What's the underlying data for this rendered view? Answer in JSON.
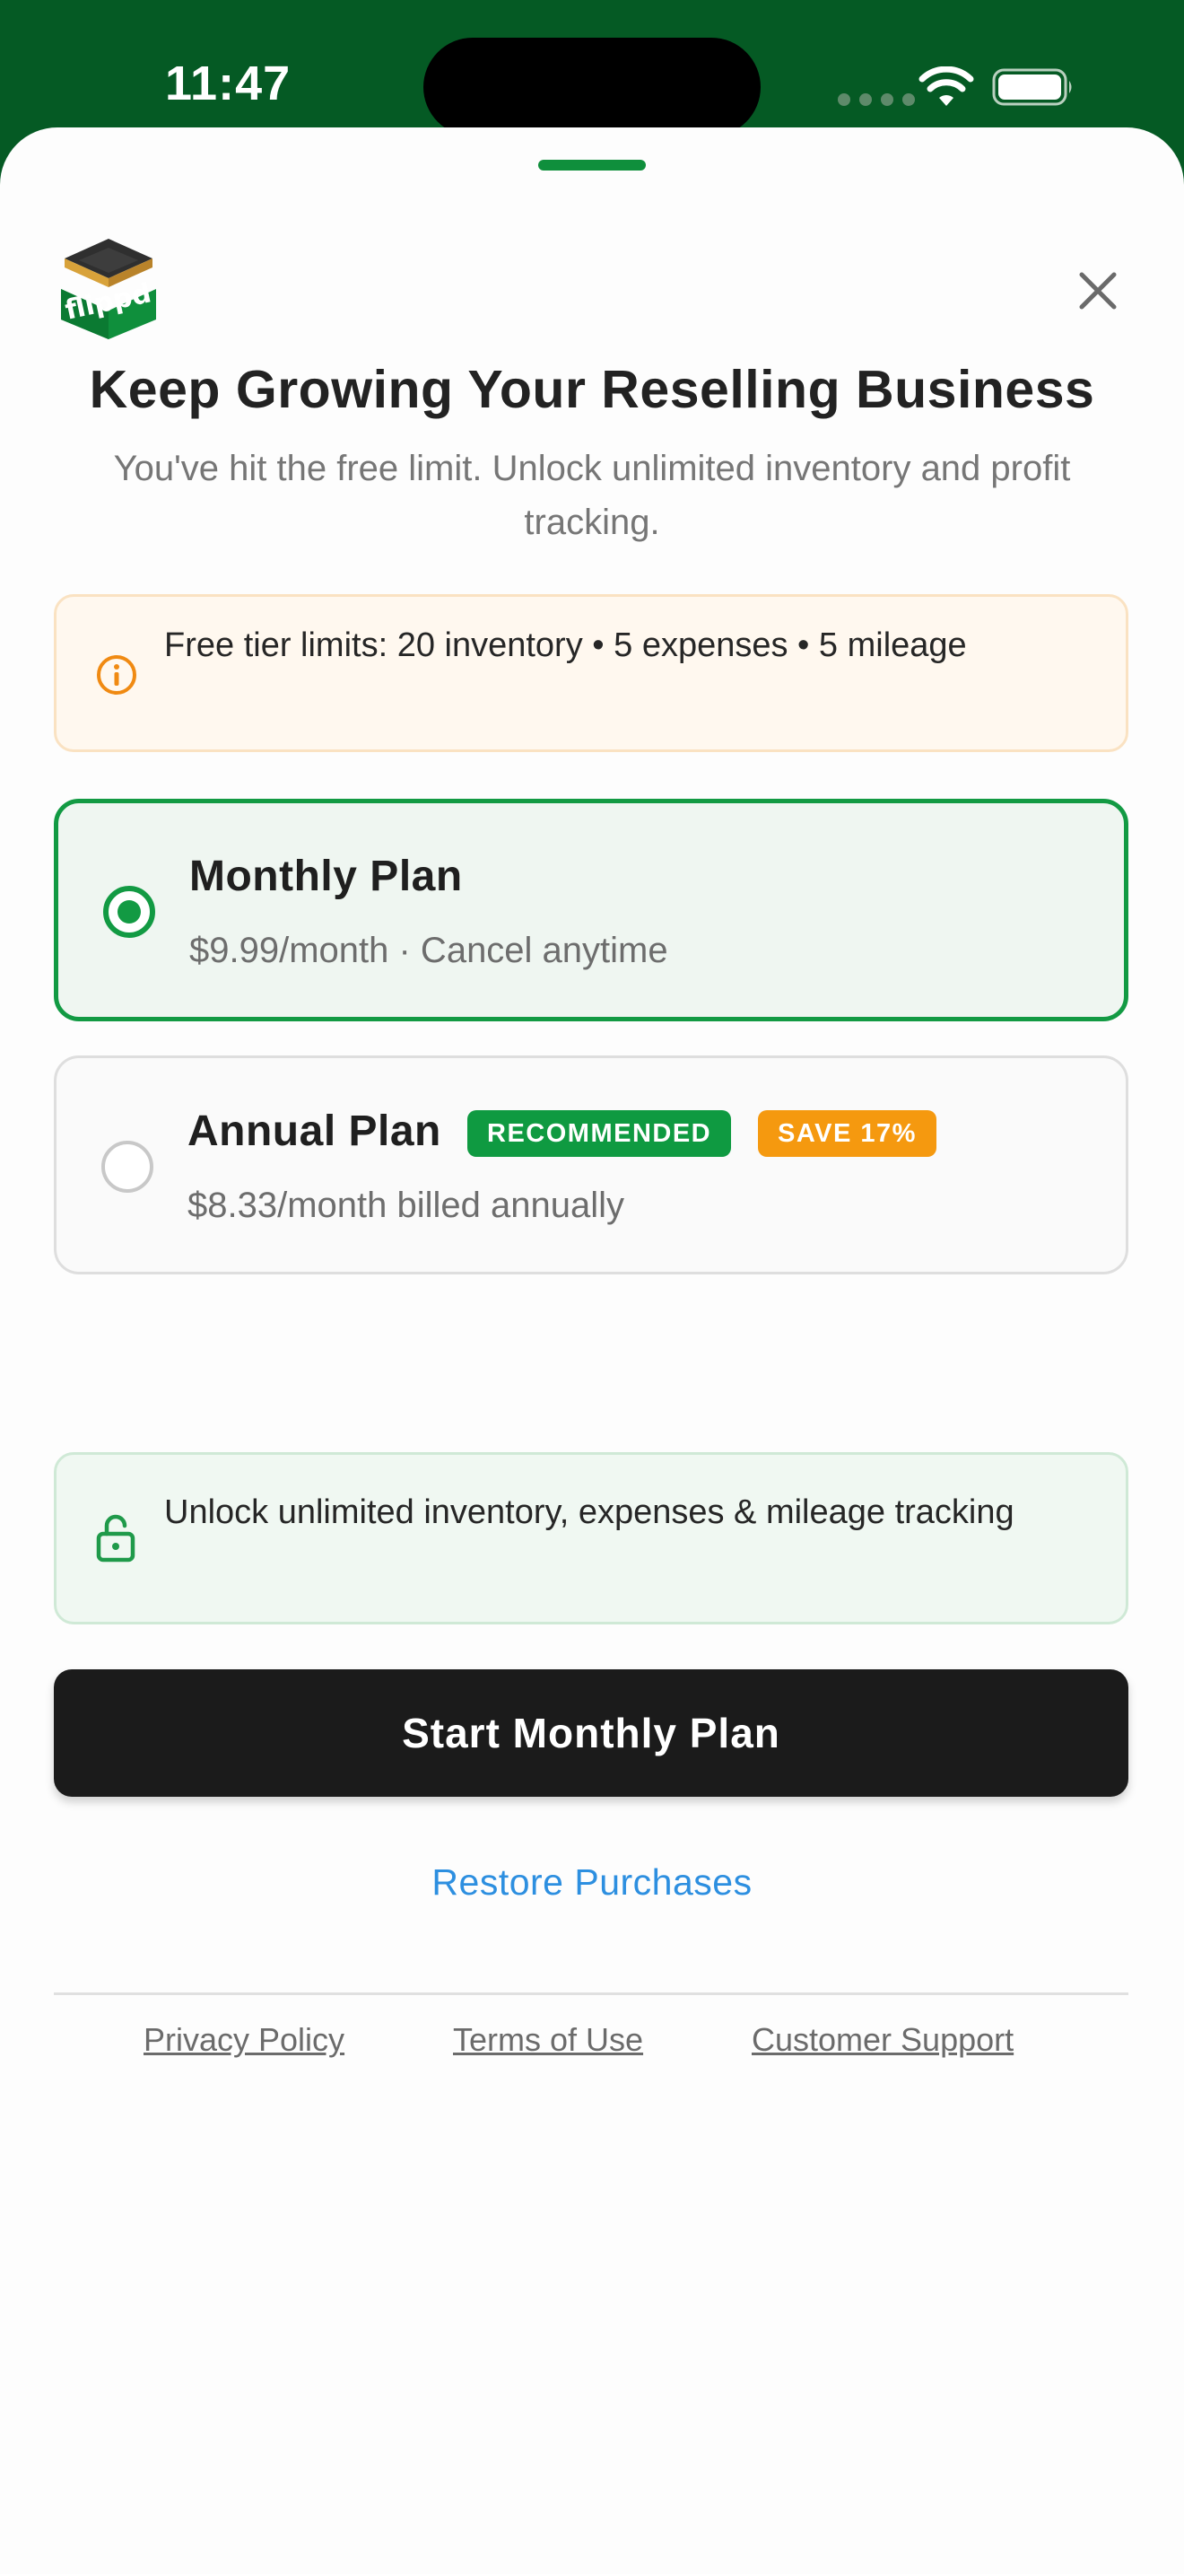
{
  "status_bar": {
    "time": "11:47"
  },
  "logo": {
    "text": "flippd"
  },
  "header": {
    "title": "Keep Growing Your Reselling Business",
    "subtitle": "You've hit the free limit. Unlock unlimited inventory and profit tracking."
  },
  "limits_banner": {
    "icon": "info-icon",
    "text": "Free tier limits: 20 inventory • 5 expenses • 5 mileage"
  },
  "plans": [
    {
      "name": "Monthly Plan",
      "price": "$9.99/month · Cancel anytime",
      "selected": true
    },
    {
      "name": "Annual Plan",
      "price": "$8.33/month billed annually",
      "selected": false,
      "badges": [
        "RECOMMENDED",
        "SAVE 17%"
      ]
    }
  ],
  "unlock_banner": {
    "icon": "lock-open-icon",
    "text": "Unlock unlimited inventory, expenses & mileage tracking"
  },
  "actions": {
    "start_label": "Start Monthly Plan",
    "restore_label": "Restore Purchases"
  },
  "footer": {
    "privacy": "Privacy Policy",
    "terms": "Terms of Use",
    "support": "Customer Support"
  },
  "colors": {
    "status_bar_bg": "#055a24",
    "brand_green": "#129a43",
    "warning_orange": "#f5990f",
    "link_blue": "#2d8fe0",
    "primary_button": "#1b1b1b"
  }
}
